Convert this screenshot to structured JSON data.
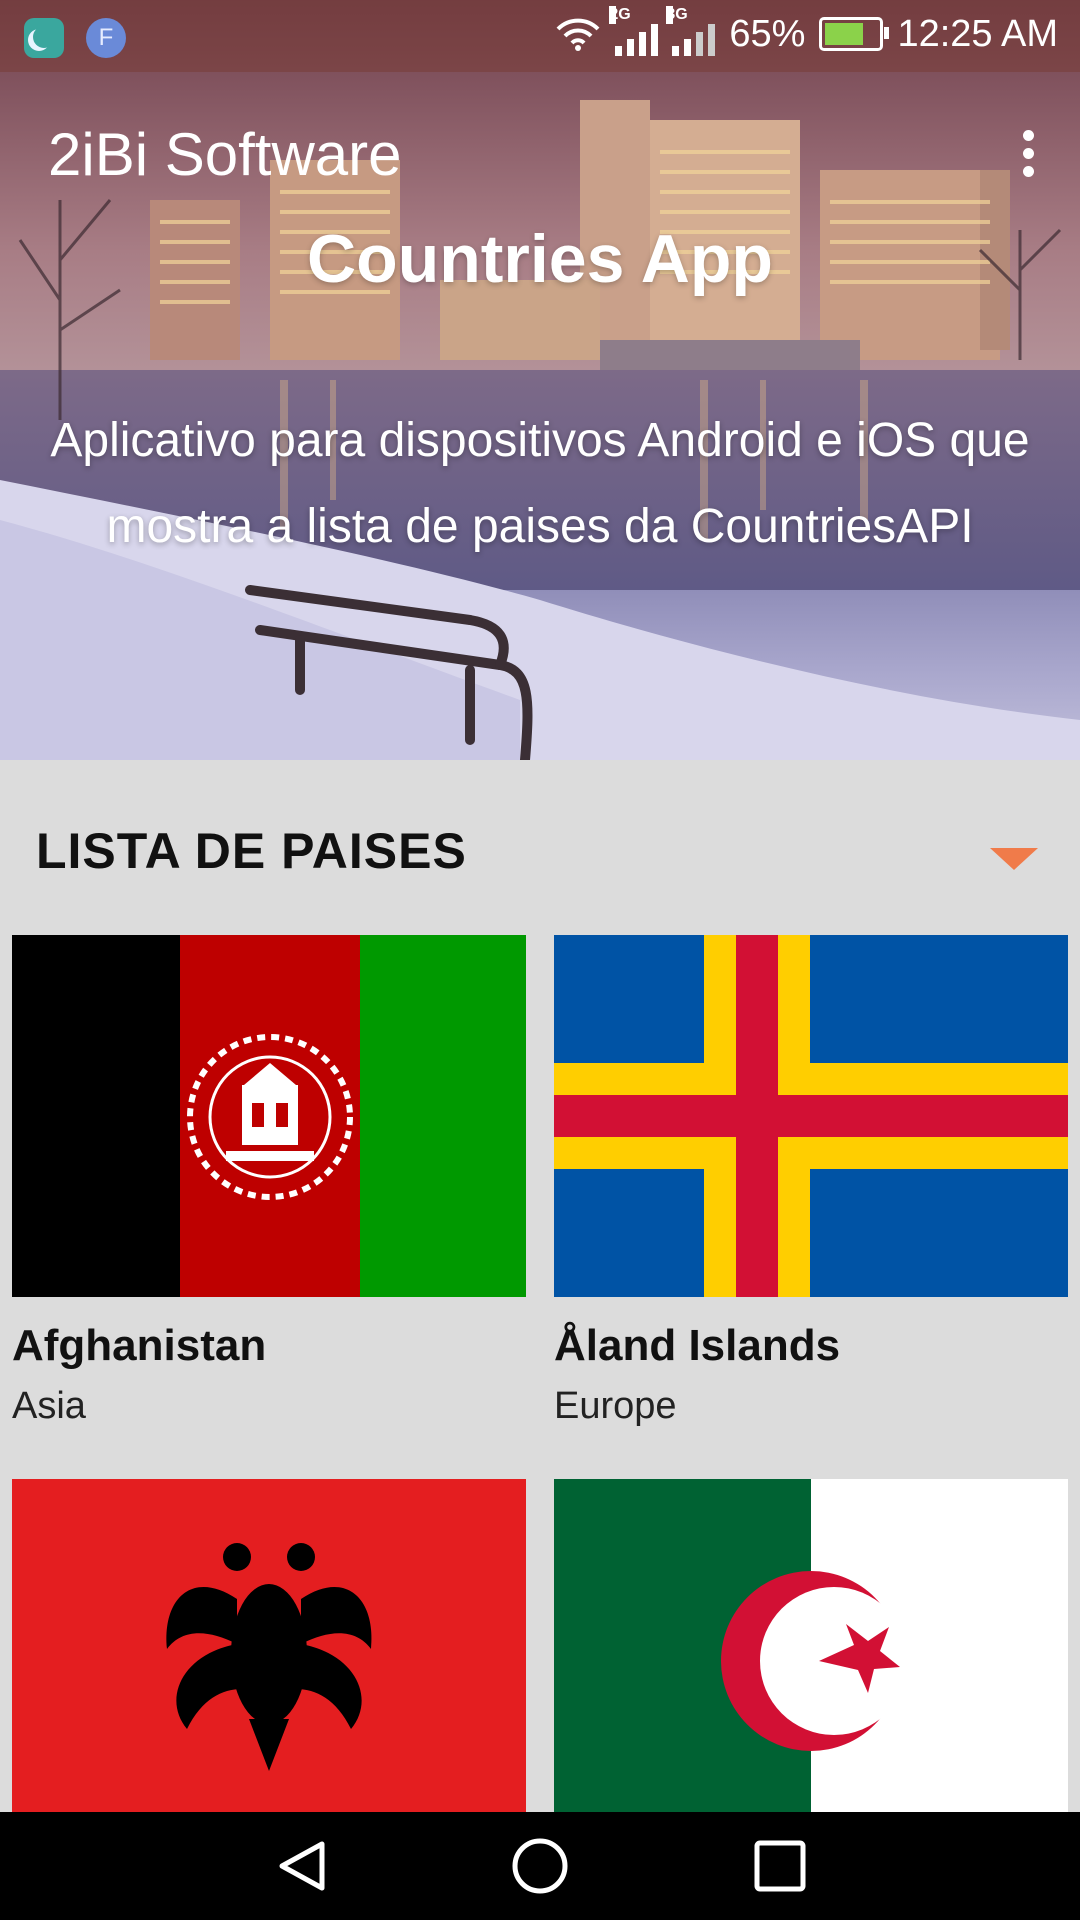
{
  "status_bar": {
    "network1": "2G",
    "network2": "3G",
    "battery": "65%",
    "time": "12:25 AM",
    "notification_letter": "F"
  },
  "header": {
    "app_title": "2iBi Software",
    "hero_title": "Countries App",
    "hero_description": "Aplicativo para dispositivos Android e iOS que mostra a lista de paises da CountriesAPI"
  },
  "section": {
    "title": "LISTA DE PAISES"
  },
  "countries": [
    {
      "name": "Afghanistan",
      "region": "Asia"
    },
    {
      "name": "Åland Islands",
      "region": "Europe"
    },
    {
      "name": "",
      "region": ""
    },
    {
      "name": "",
      "region": ""
    }
  ],
  "colors": {
    "accent": "#f07b4a",
    "background": "#dcdcdc",
    "navbar": "#000000"
  },
  "icons": [
    "moon-icon",
    "wifi-icon",
    "signal-icon",
    "battery-icon",
    "more-vert-icon",
    "chevron-down-icon",
    "back-icon",
    "home-icon",
    "recent-apps-icon"
  ]
}
